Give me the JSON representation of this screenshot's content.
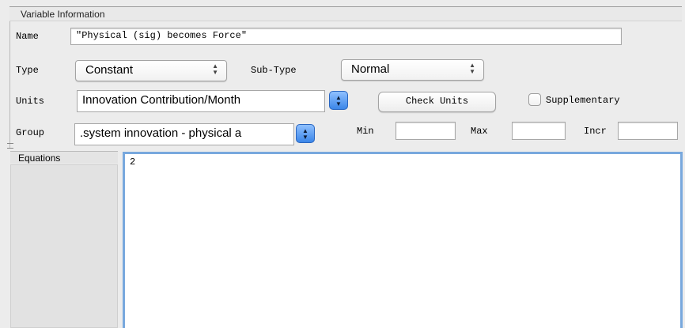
{
  "panel": {
    "title": "Variable Information"
  },
  "fields": {
    "name": {
      "label": "Name",
      "value": "\"Physical (sig) becomes Force\""
    },
    "type": {
      "label": "Type",
      "value": "Constant"
    },
    "subtype": {
      "label": "Sub-Type",
      "value": "Normal"
    },
    "units": {
      "label": "Units",
      "value": "Innovation Contribution/Month"
    },
    "check_units": {
      "label": "Check Units"
    },
    "supplementary": {
      "label": "Supplementary",
      "checked": false
    },
    "group": {
      "label": "Group",
      "value": ".system innovation - physical a"
    },
    "min": {
      "label": "Min",
      "value": ""
    },
    "max": {
      "label": "Max",
      "value": ""
    },
    "incr": {
      "label": "Incr",
      "value": ""
    }
  },
  "equations": {
    "label": "Equations",
    "content": "2"
  },
  "icons": {
    "popup_arrows": "up-down-chevron-icon",
    "combo_button": "blue-updown-stepper-icon"
  },
  "colors": {
    "focus_ring": "#78a8dd",
    "combo_blue": "#3b86e8"
  }
}
